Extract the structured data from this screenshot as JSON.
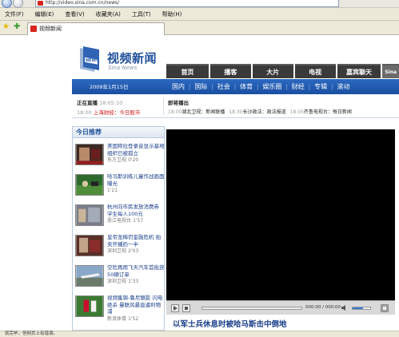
{
  "browser": {
    "url": "http://video.sina.com.cn/news/",
    "menu": [
      "文件(F)",
      "编辑(E)",
      "查看(V)",
      "收藏夹(A)",
      "工具(T)",
      "帮助(H)"
    ],
    "tab_title": "视频新闻",
    "status_text": "就完毕，但网页上有错误。"
  },
  "logo": {
    "title": "视频新闻",
    "subtitle": "Sina News",
    "badge": "NEWS"
  },
  "topnav": [
    "首页",
    "播客",
    "大片",
    "电视",
    "嘉宾聊天",
    "Sina"
  ],
  "subnav": {
    "date": "2009年1月15日",
    "items": [
      "国内",
      "国际",
      "社会",
      "体育",
      "娱乐圈",
      "财经",
      "专辑",
      "滚动"
    ]
  },
  "schedule": {
    "live_label": "正在直播",
    "live_time": "18:05:10",
    "live_prog_time": "18:00",
    "live_prog": "上海财经：今日股市",
    "next_label": "即将播出",
    "next": [
      {
        "time": "18:00",
        "text": "湖北卫视：新闻联播"
      },
      {
        "time": "18:30",
        "text": "长沙政法：政法报道"
      },
      {
        "time": "18:05",
        "text": "齐鲁电视台：每日新闻"
      }
    ]
  },
  "recommend": {
    "header": "今日推荐",
    "items": [
      {
        "title": "美国称拉登录音显示基地组织已被孤立",
        "source": "东方卫视",
        "duration": "0'20"
      },
      {
        "title": "哈马斯训练儿童作战画面曝光",
        "source": "",
        "duration": "1'21"
      },
      {
        "title": "杭州向市民发放消费券 学生每人100元",
        "source": "浙江电视台",
        "duration": "1'57"
      },
      {
        "title": "皇帝龙梅罚金融危机 拍卖开播扔一半",
        "source": "深圳卫视",
        "duration": "2'03"
      },
      {
        "title": "空险再用飞天汽车首批获50辆订单",
        "source": "深圳卫视",
        "duration": "1'33"
      },
      {
        "title": "视频集锦-鲁尼魅影 闪电绝杀 曼联风暴直逼利物浦",
        "source": "新浪体育",
        "duration": "1'52"
      }
    ]
  },
  "player": {
    "time": "000:00 / 000:00",
    "volume": 0.6,
    "progress": 0.0
  },
  "video_title": "以军士兵休息时被哈马斯击中倒地",
  "colors": {
    "brand_blue": "#1f4f9a",
    "nav_dark": "#3a3a3a",
    "bar_blue": "#2c69c2",
    "live_red": "#cc1a1a"
  }
}
